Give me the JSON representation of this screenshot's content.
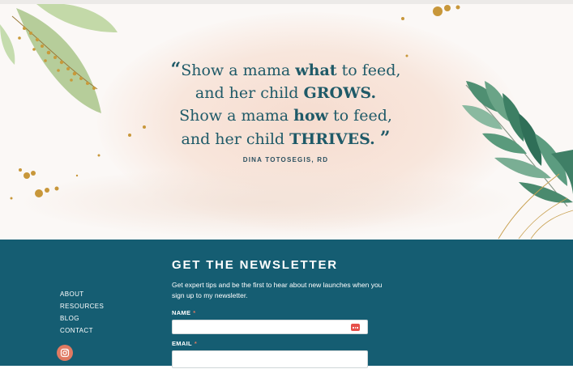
{
  "quote": {
    "open_mark": "“",
    "close_mark": "”",
    "l1_a": "Show a mama ",
    "l1_b": "what",
    "l1_c": " to feed,",
    "l2_a": "and her child ",
    "l2_b": "GROWS.",
    "l3_a": "Show a mama ",
    "l3_b": "how",
    "l3_c": " to feed,",
    "l4_a": "and her child ",
    "l4_b": "THRIVES.",
    "attribution": "DINA TOTOSEGIS, RD"
  },
  "footer": {
    "nav": [
      "ABOUT",
      "RESOURCES",
      "BLOG",
      "CONTACT"
    ],
    "social_icon": "instagram-icon",
    "accent": "#155d72"
  },
  "newsletter": {
    "title": "GET THE NEWSLETTER",
    "description": "Get expert tips and be the first to hear about new launches when you sign up to my newsletter.",
    "name_label": "NAME",
    "email_label": "EMAIL",
    "required_mark": "*",
    "name_value": "",
    "email_value": ""
  }
}
